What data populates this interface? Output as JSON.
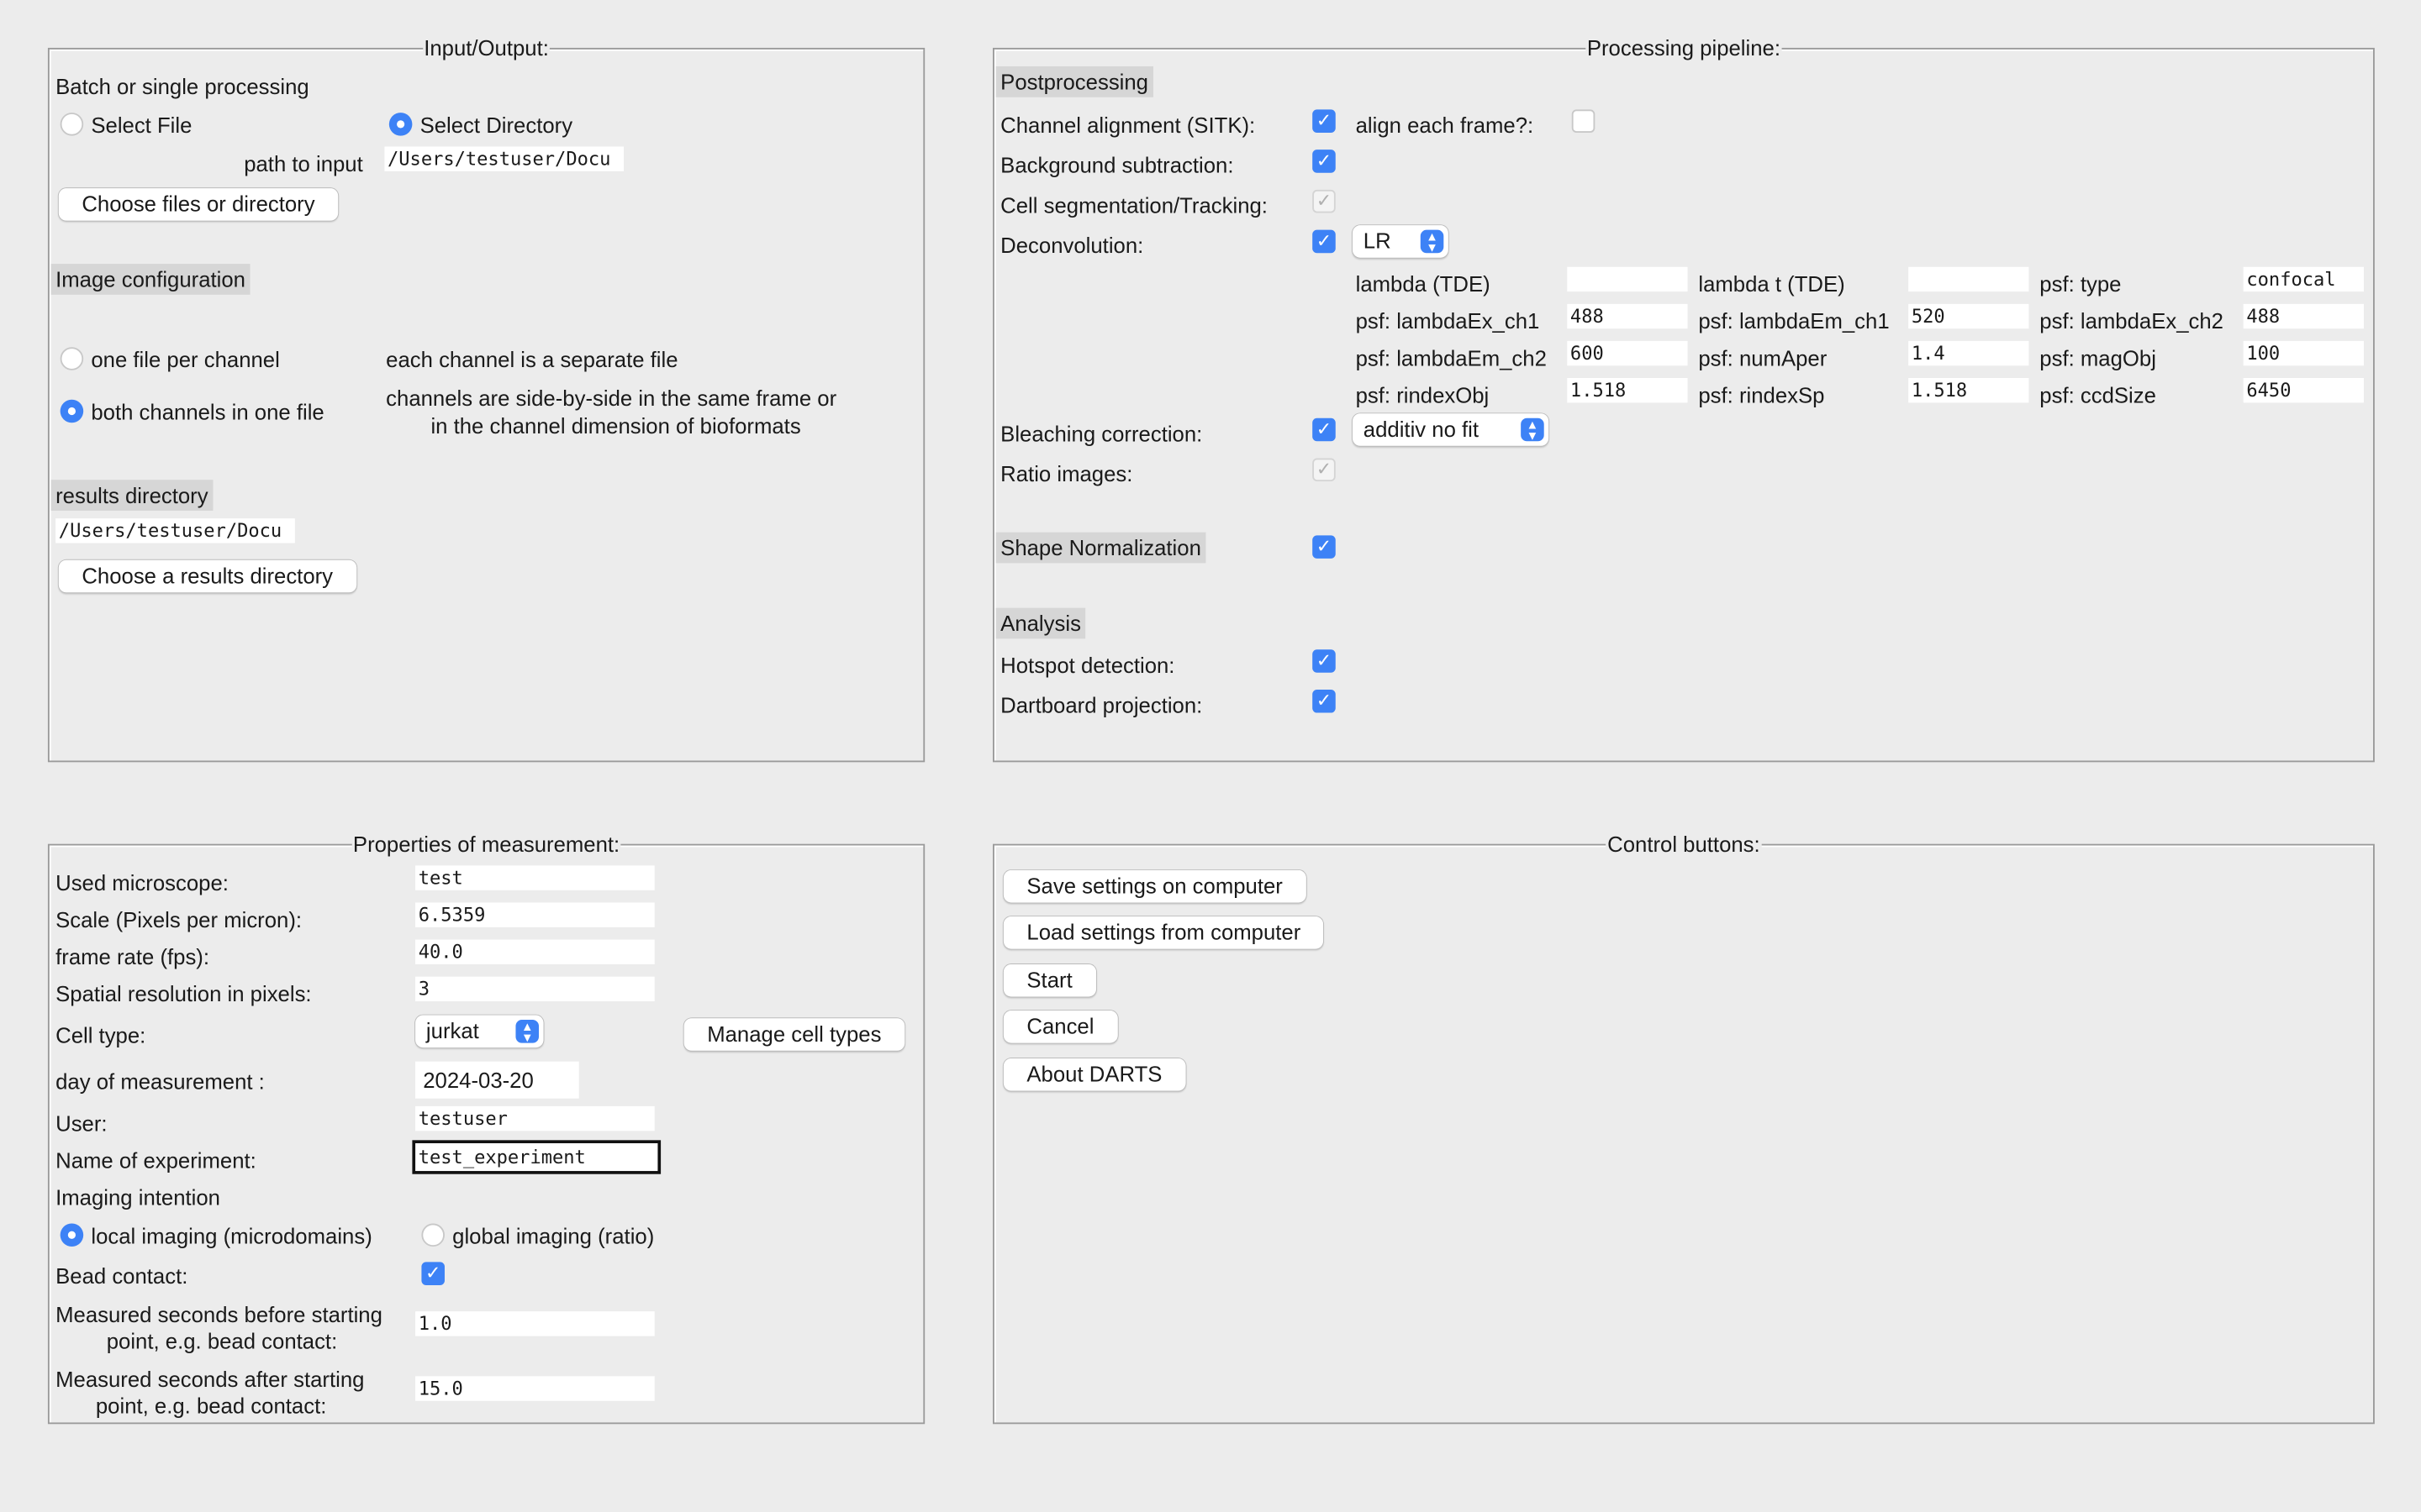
{
  "io": {
    "title": "Input/Output:",
    "batch_label": "Batch or single processing",
    "select_file": "Select File",
    "select_directory": "Select Directory",
    "path_label": "path to input",
    "path_value": "/Users/testuser/Docu",
    "choose_button": "Choose files or directory",
    "image_config": "Image configuration",
    "one_file": "one file per channel",
    "one_file_desc": "each channel is a separate file",
    "both_channels": "both channels in one file",
    "both_desc_1": "channels are side-by-side in the same frame or",
    "both_desc_2": "in the channel dimension of bioformats",
    "results_label": "results directory",
    "results_value": "/Users/testuser/Docu",
    "results_button": "Choose a results directory"
  },
  "pipeline": {
    "title": "Processing pipeline:",
    "postprocessing": "Postprocessing",
    "channel_alignment": "Channel alignment (SITK):",
    "align_each": "align each frame?:",
    "background": "Background subtraction:",
    "segmentation": "Cell segmentation/Tracking:",
    "deconvolution": "Deconvolution:",
    "deconv_method": "LR",
    "params": [
      {
        "label": "lambda (TDE)",
        "value": ""
      },
      {
        "label": "lambda t (TDE)",
        "value": ""
      },
      {
        "label": "psf: type",
        "value": "confocal"
      },
      {
        "label": "psf: lambdaEx_ch1",
        "value": "488"
      },
      {
        "label": "psf: lambdaEm_ch1",
        "value": "520"
      },
      {
        "label": "psf: lambdaEx_ch2",
        "value": "488"
      },
      {
        "label": "psf: lambdaEm_ch2",
        "value": "600"
      },
      {
        "label": "psf: numAper",
        "value": "1.4"
      },
      {
        "label": "psf: magObj",
        "value": "100"
      },
      {
        "label": "psf: rindexObj",
        "value": "1.518"
      },
      {
        "label": "psf: rindexSp",
        "value": "1.518"
      },
      {
        "label": "psf: ccdSize",
        "value": "6450"
      }
    ],
    "bleaching": "Bleaching correction:",
    "bleaching_method": "additiv no fit",
    "ratio": "Ratio images:",
    "shape_norm": "Shape Normalization",
    "analysis": "Analysis",
    "hotspot": "Hotspot detection:",
    "dartboard": "Dartboard projection:"
  },
  "props": {
    "title": "Properties of measurement:",
    "microscope_label": "Used microscope:",
    "microscope": "test",
    "scale_label": "Scale (Pixels per micron):",
    "scale": "6.5359",
    "fps_label": "frame rate (fps):",
    "fps": "40.0",
    "spatial_label": "Spatial resolution in pixels:",
    "spatial": "3",
    "cell_type_label": "Cell type:",
    "cell_type": "jurkat",
    "manage_button": "Manage cell types",
    "day_label": "day of measurement :",
    "day": "2024-03-20",
    "user_label": "User:",
    "user": "testuser",
    "experiment_label": "Name of experiment:",
    "experiment": "test_experiment",
    "intention_label": "Imaging intention",
    "local": "local imaging (microdomains)",
    "global": "global imaging (ratio)",
    "bead_label": "Bead contact:",
    "before_1": "Measured seconds before starting",
    "before_2": "point, e.g. bead contact:",
    "before": "1.0",
    "after_1": "Measured seconds after starting",
    "after_2": "point, e.g. bead contact:",
    "after": "15.0"
  },
  "control": {
    "title": "Control buttons:",
    "save": "Save settings on computer",
    "load": "Load settings from computer",
    "start": "Start",
    "cancel": "Cancel",
    "about": "About DARTS"
  },
  "colors": {
    "accent": "#3d82f6",
    "background": "#ececec"
  }
}
